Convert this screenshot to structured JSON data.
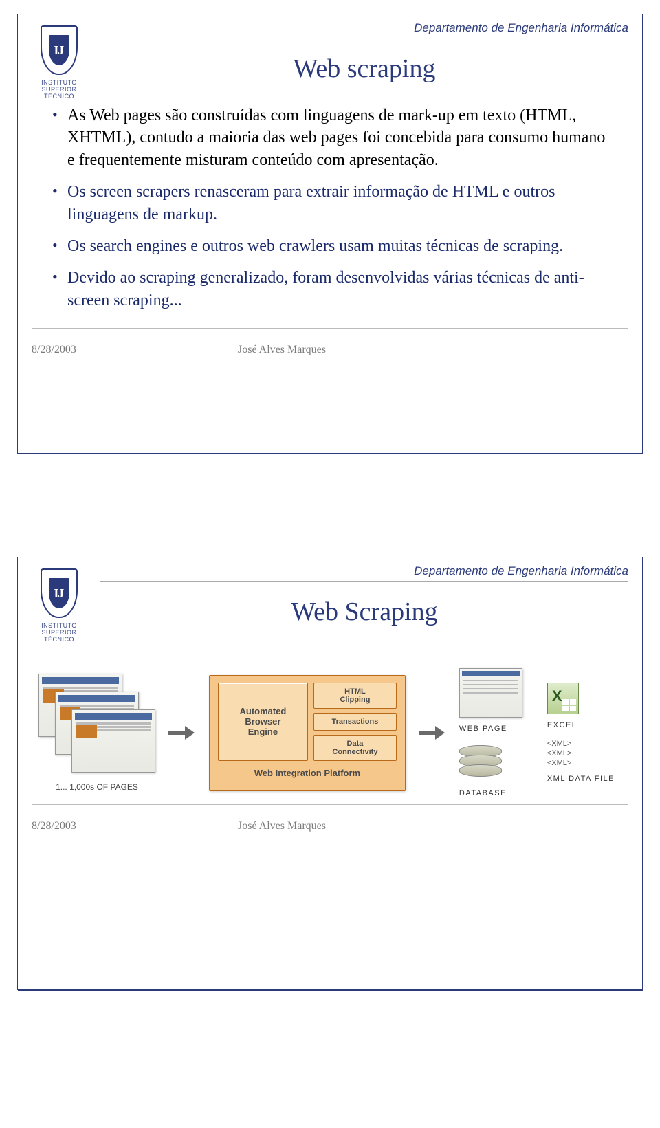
{
  "header": {
    "department": "Departamento de Engenharia Informática",
    "logo_text1": "INSTITUTO",
    "logo_text2": "SUPERIOR",
    "logo_text3": "TÉCNICO",
    "logo_monogram": "Ĳ"
  },
  "slide1": {
    "title": "Web scraping",
    "bullets": [
      "As Web pages são construídas com linguagens de mark-up em texto (HTML, XHTML), contudo a maioria das web pages foi concebida para consumo humano e frequentemente misturam conteúdo com apresentação.",
      "Os screen scrapers renasceram para extrair informação de HTML e outros linguagens de markup.",
      "Os search engines e outros web crawlers usam muitas técnicas de scraping.",
      "Devido ao scraping generalizado, foram desenvolvidas várias técnicas de anti-screen scraping..."
    ]
  },
  "slide2": {
    "title": "Web Scraping",
    "diagram": {
      "pages_caption": "1... 1,000s OF PAGES",
      "abe": "Automated\nBrowser\nEngine",
      "box1": "HTML\nClipping",
      "box2": "Transactions",
      "box3": "Data\nConnectivity",
      "platform": "Web Integration Platform",
      "webpage": "WEB PAGE",
      "database": "DATABASE",
      "excel": "EXCEL",
      "xml1": "<XML>",
      "xml2": "<XML>",
      "xml3": "<XML>",
      "xmlfile": "XML DATA FILE"
    }
  },
  "footer": {
    "date": "8/28/2003",
    "author": "José Alves Marques"
  }
}
